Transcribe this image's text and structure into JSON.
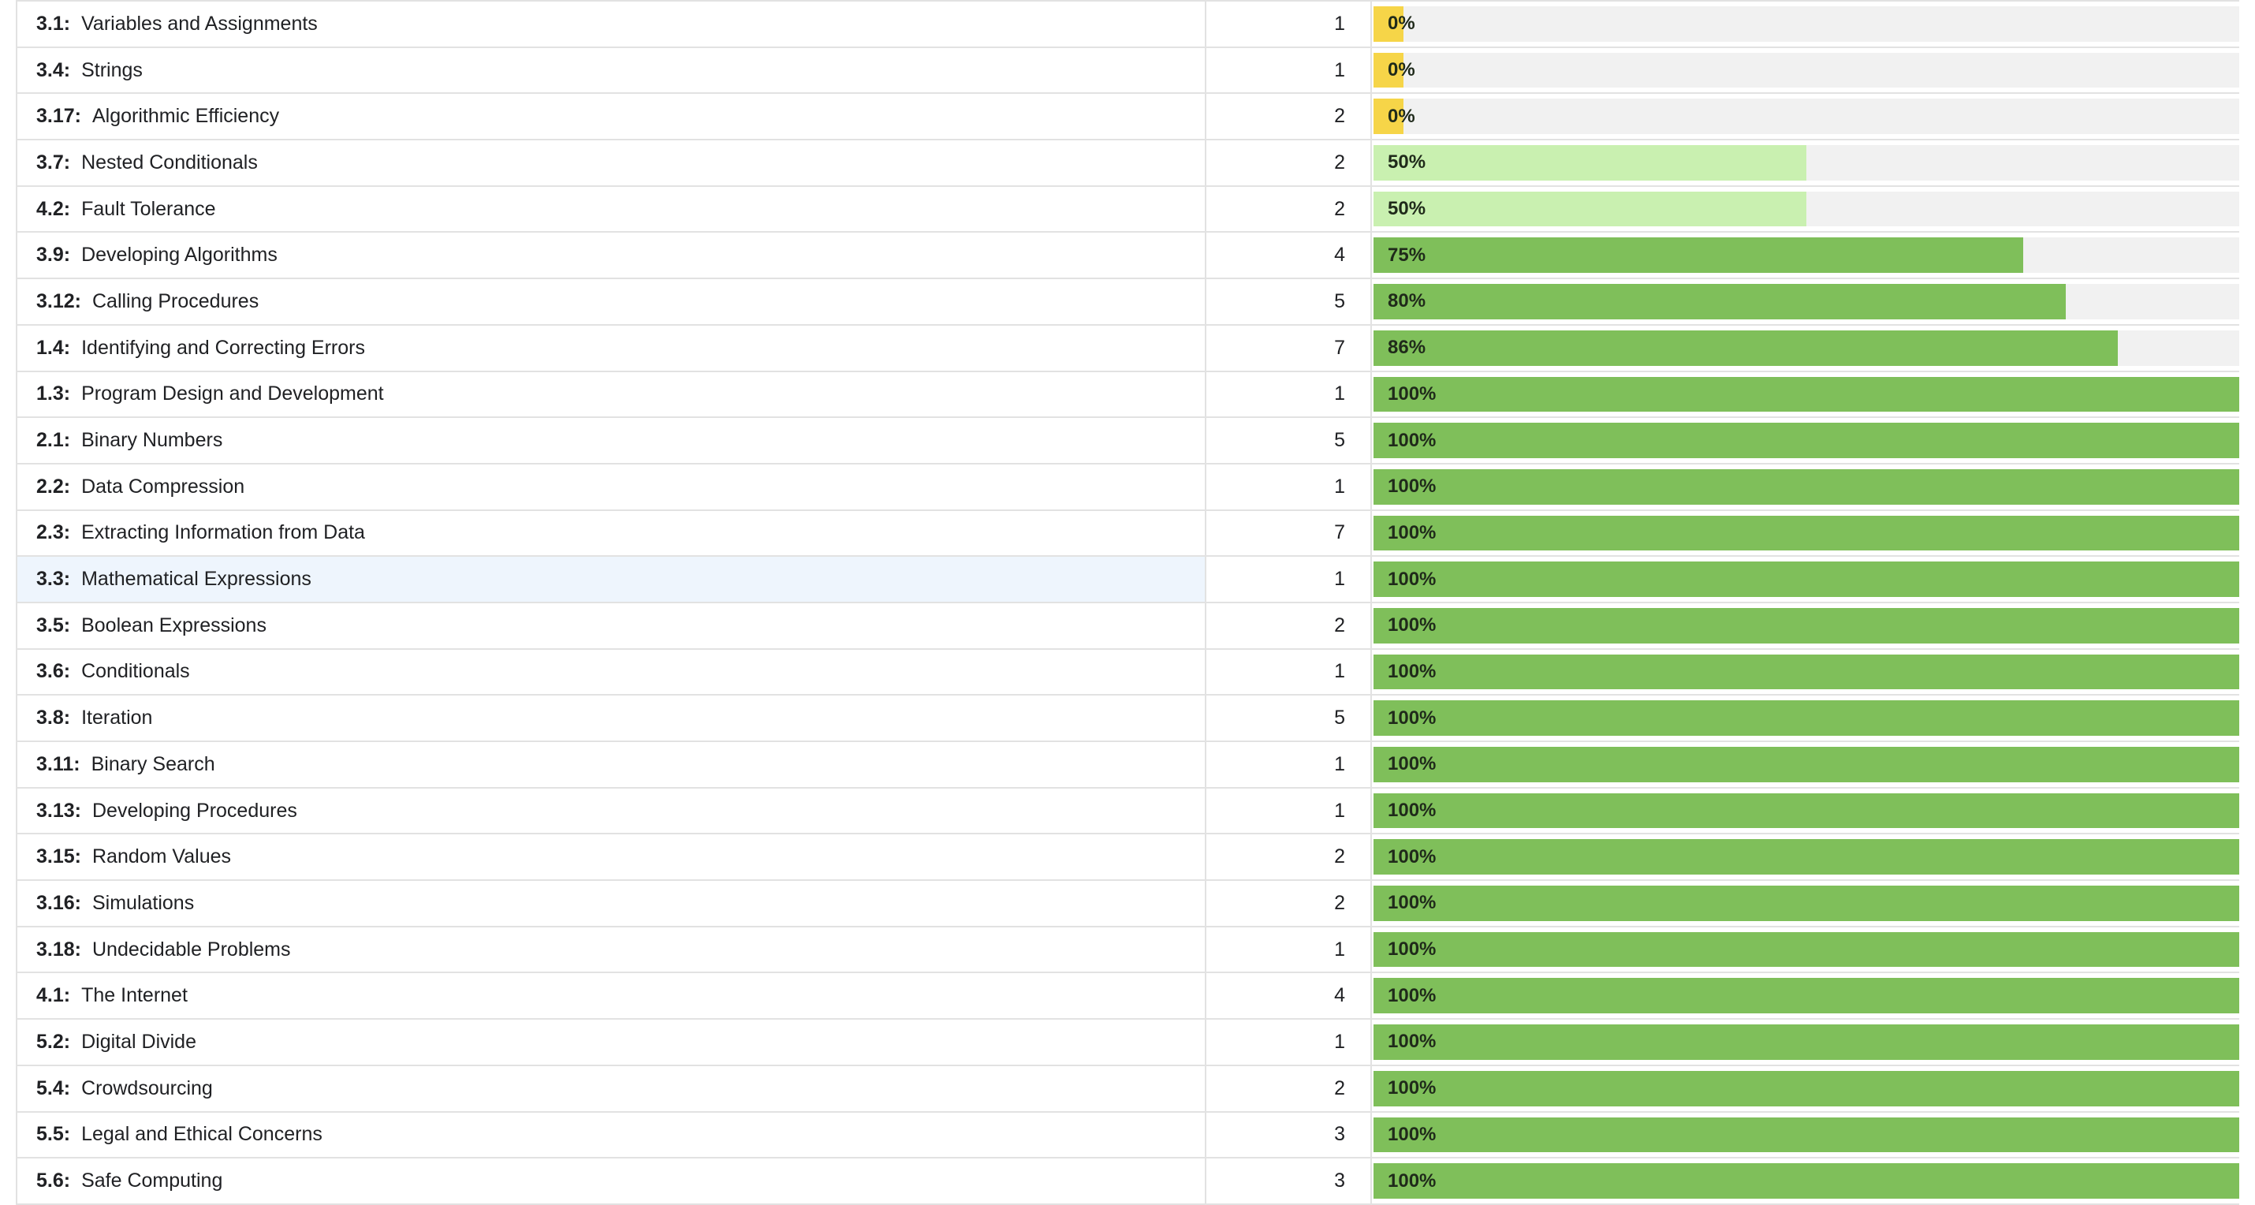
{
  "colors": {
    "full": "#7fbf5a",
    "partial": "#c9f0b0",
    "zero": "#f6d548",
    "track": "#f1f1f1"
  },
  "rows": [
    {
      "code": "3.1:",
      "name": "Variables and Assignments",
      "count": "1",
      "percent": 0,
      "label": "0%"
    },
    {
      "code": "3.4:",
      "name": "Strings",
      "count": "1",
      "percent": 0,
      "label": "0%"
    },
    {
      "code": "3.17:",
      "name": "Algorithmic Efficiency",
      "count": "2",
      "percent": 0,
      "label": "0%"
    },
    {
      "code": "3.7:",
      "name": "Nested Conditionals",
      "count": "2",
      "percent": 50,
      "label": "50%"
    },
    {
      "code": "4.2:",
      "name": "Fault Tolerance",
      "count": "2",
      "percent": 50,
      "label": "50%"
    },
    {
      "code": "3.9:",
      "name": "Developing Algorithms",
      "count": "4",
      "percent": 75,
      "label": "75%"
    },
    {
      "code": "3.12:",
      "name": "Calling Procedures",
      "count": "5",
      "percent": 80,
      "label": "80%"
    },
    {
      "code": "1.4:",
      "name": "Identifying and Correcting Errors",
      "count": "7",
      "percent": 86,
      "label": "86%"
    },
    {
      "code": "1.3:",
      "name": "Program Design and Development",
      "count": "1",
      "percent": 100,
      "label": "100%"
    },
    {
      "code": "2.1:",
      "name": "Binary Numbers",
      "count": "5",
      "percent": 100,
      "label": "100%"
    },
    {
      "code": "2.2:",
      "name": "Data Compression",
      "count": "1",
      "percent": 100,
      "label": "100%"
    },
    {
      "code": "2.3:",
      "name": "Extracting Information from Data",
      "count": "7",
      "percent": 100,
      "label": "100%"
    },
    {
      "code": "3.3:",
      "name": "Mathematical Expressions",
      "count": "1",
      "percent": 100,
      "label": "100%",
      "highlight": true
    },
    {
      "code": "3.5:",
      "name": "Boolean Expressions",
      "count": "2",
      "percent": 100,
      "label": "100%"
    },
    {
      "code": "3.6:",
      "name": "Conditionals",
      "count": "1",
      "percent": 100,
      "label": "100%"
    },
    {
      "code": "3.8:",
      "name": "Iteration",
      "count": "5",
      "percent": 100,
      "label": "100%"
    },
    {
      "code": "3.11:",
      "name": "Binary Search",
      "count": "1",
      "percent": 100,
      "label": "100%"
    },
    {
      "code": "3.13:",
      "name": "Developing Procedures",
      "count": "1",
      "percent": 100,
      "label": "100%"
    },
    {
      "code": "3.15:",
      "name": "Random Values",
      "count": "2",
      "percent": 100,
      "label": "100%"
    },
    {
      "code": "3.16:",
      "name": "Simulations",
      "count": "2",
      "percent": 100,
      "label": "100%"
    },
    {
      "code": "3.18:",
      "name": "Undecidable Problems",
      "count": "1",
      "percent": 100,
      "label": "100%"
    },
    {
      "code": "4.1:",
      "name": "The Internet",
      "count": "4",
      "percent": 100,
      "label": "100%"
    },
    {
      "code": "5.2:",
      "name": "Digital Divide",
      "count": "1",
      "percent": 100,
      "label": "100%"
    },
    {
      "code": "5.4:",
      "name": "Crowdsourcing",
      "count": "2",
      "percent": 100,
      "label": "100%"
    },
    {
      "code": "5.5:",
      "name": "Legal and Ethical Concerns",
      "count": "3",
      "percent": 100,
      "label": "100%"
    },
    {
      "code": "5.6:",
      "name": "Safe Computing",
      "count": "3",
      "percent": 100,
      "label": "100%"
    }
  ]
}
